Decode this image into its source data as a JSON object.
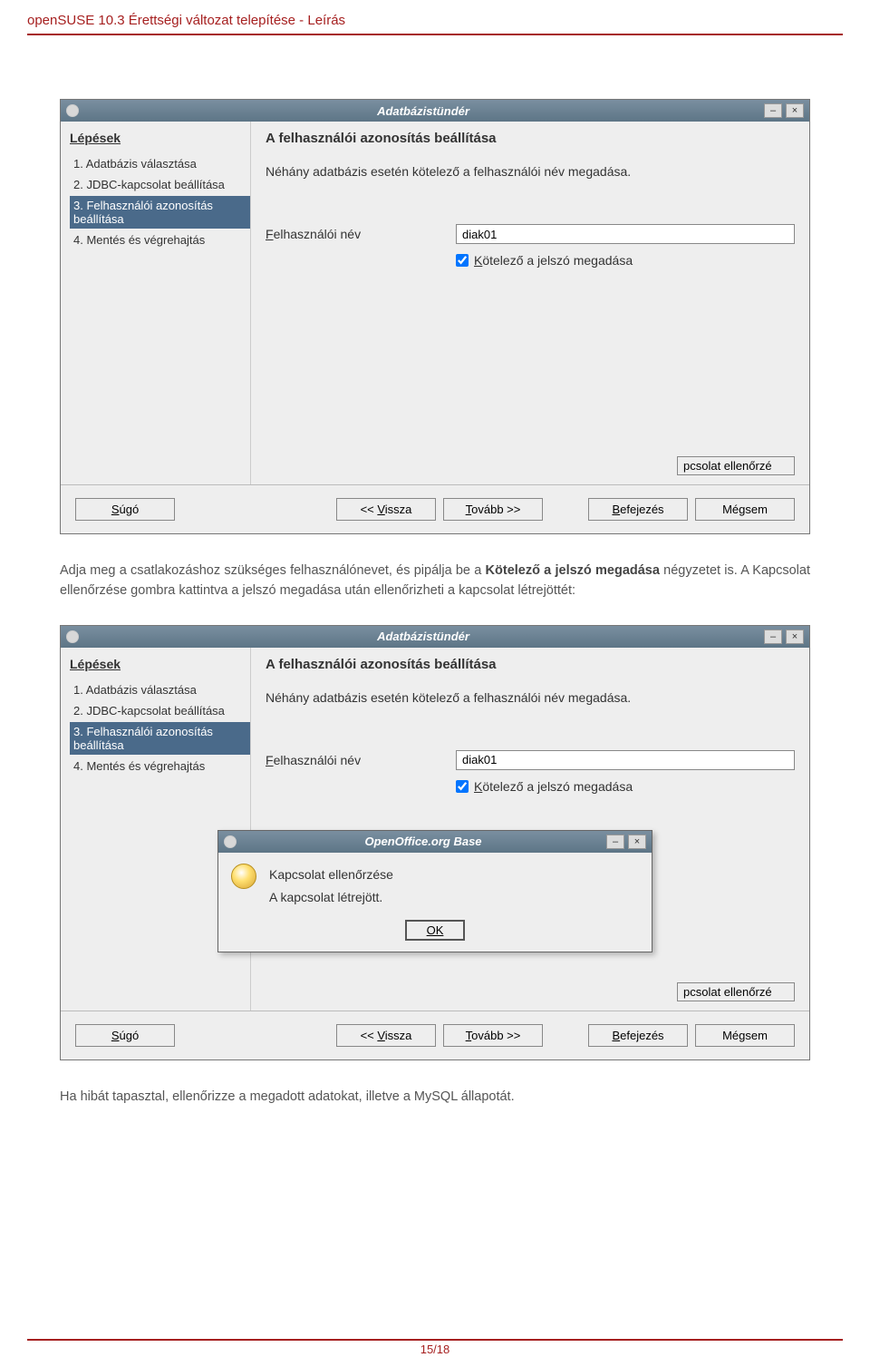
{
  "header": "openSUSE 10.3 Érettségi változat telepítése - Leírás",
  "wizard": {
    "title": "Adatbázistündér",
    "steps_heading": "Lépések",
    "steps": [
      "1. Adatbázis választása",
      "2. JDBC-kapcsolat beállítása",
      "3. Felhasználói azonosítás beállítása",
      "4. Mentés és végrehajtás"
    ],
    "content_title": "A felhasználói azonosítás beállítása",
    "desc": "Néhány adatbázis esetén kötelező a felhasználói név megadása.",
    "username_label": "Felhasználói név",
    "username_value": "diak01",
    "password_required_label": "Kötelező a jelszó megadása",
    "truncated_button": "pcsolat ellenőrzé",
    "buttons": {
      "help": "Súgó",
      "back": "<< Vissza",
      "next": "Tovább >>",
      "finish": "Befejezés",
      "cancel": "Mégsem"
    },
    "win_minimize": "–",
    "win_close": "×"
  },
  "dialog": {
    "title": "OpenOffice.org Base",
    "heading": "Kapcsolat ellenőrzése",
    "message": "A kapcsolat létrejött.",
    "ok": "OK"
  },
  "body_text": {
    "p1_a": "Adja meg a csatlakozáshoz szükséges felhasználónevet, és pipálja be a ",
    "p1_b": "Kötelező a jelszó megadása",
    "p1_c": " négyzetet is. A Kapcsolat ellenőrzése gombra kattintva a jelszó megadása után ellenőrizheti a kapcsolat létre­jöttét:",
    "p2": "Ha hibát tapasztal, ellenőrizze a megadott adatokat, illetve a MySQL állapotát."
  },
  "footer": "15/18"
}
